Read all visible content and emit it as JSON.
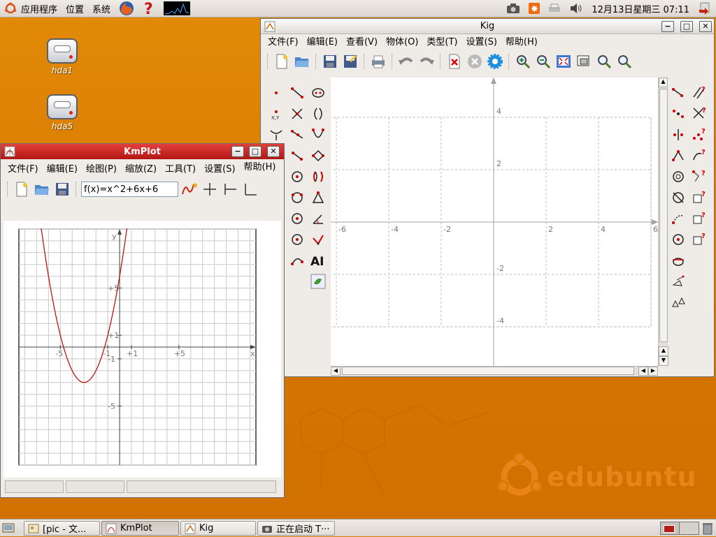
{
  "top_panel": {
    "menus": [
      "应用程序",
      "位置",
      "系统"
    ],
    "clock": "12月13日星期三 07:11"
  },
  "desktop": {
    "icons": [
      {
        "label": "hda1"
      },
      {
        "label": "hda5"
      }
    ],
    "brand": "edubuntu",
    "brand_color": "#e8841a"
  },
  "kig": {
    "title": "Kig",
    "menus": [
      "文件(F)",
      "编辑(E)",
      "查看(V)",
      "物体(O)",
      "类型(T)",
      "设置(S)",
      "帮助(H)"
    ],
    "x_ticks": [
      "-6",
      "-4",
      "-2",
      "2",
      "4",
      "6"
    ],
    "y_ticks": [
      "4",
      "2",
      "-2",
      "-4"
    ]
  },
  "kmplot": {
    "title": "KmPlot",
    "menus": [
      "文件(F)",
      "编辑(E)",
      "绘图(P)",
      "缩放(Z)",
      "工具(T)",
      "设置(S)",
      "帮助(H)"
    ],
    "function_input": "f(x)=x^2+6x+6",
    "x_ticks": [
      "-5",
      "-1",
      "+1",
      "+5"
    ],
    "y_ticks": [
      "+5",
      "+1",
      "-1",
      "-5"
    ],
    "x_axis_label": "x",
    "y_axis_label": "y",
    "curve_color": "#c00000"
  },
  "taskbar": {
    "items": [
      {
        "label": "[pic - 文..."
      },
      {
        "label": "KmPlot"
      },
      {
        "label": "Kig"
      },
      {
        "label": "正在启动 T···"
      }
    ]
  }
}
